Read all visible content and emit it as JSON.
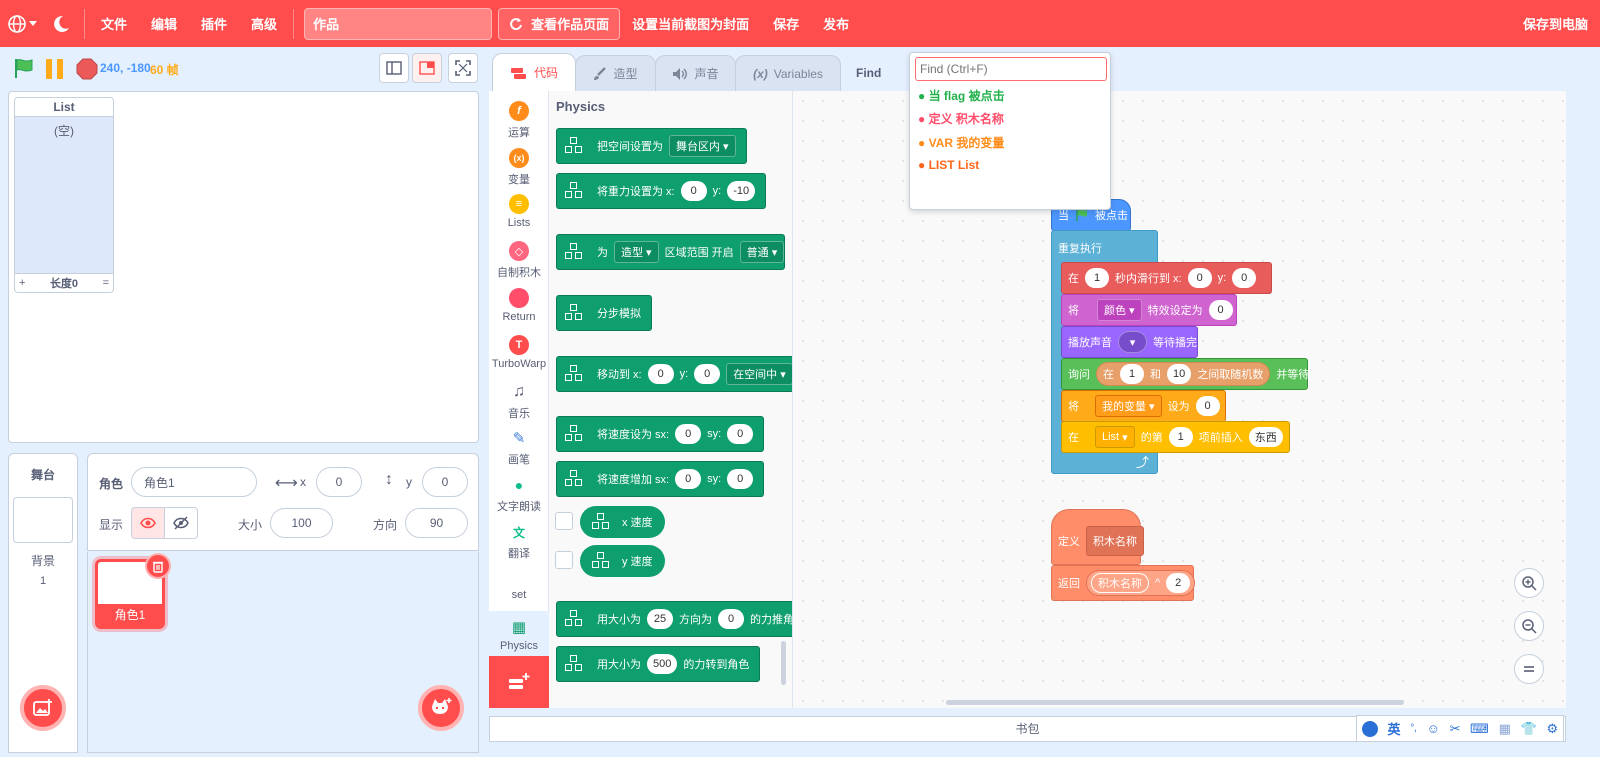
{
  "menubar": {
    "items": [
      "文件",
      "编辑",
      "插件",
      "高级"
    ],
    "project_title": "作品",
    "see_project": "查看作品页面",
    "set_cover": "设置当前截图为封面",
    "save": "保存",
    "publish": "发布",
    "save_local": "保存到电脑"
  },
  "stage_header": {
    "coords": "240, -180",
    "fps": "60 帧"
  },
  "list_monitor": {
    "title": "List",
    "empty": "(空)",
    "add": "+",
    "length": "长度0",
    "resize": "="
  },
  "stage_panel": {
    "label": "舞台",
    "backdrop_label": "背景",
    "backdrop_count": "1"
  },
  "sprite_info": {
    "sprite_label": "角色",
    "sprite_name": "角色1",
    "x_label": "x",
    "x_value": "0",
    "y_label": "y",
    "y_value": "0",
    "show_label": "显示",
    "size_label": "大小",
    "size_value": "100",
    "direction_label": "方向",
    "direction_value": "90"
  },
  "sprite_list": {
    "sprites": [
      {
        "name": "角色1"
      }
    ]
  },
  "tabs": {
    "code": "代码",
    "costumes": "造型",
    "sounds": "声音",
    "variables": "Variables",
    "find": "Find"
  },
  "categories": [
    {
      "label": "运算",
      "color": "#ff8c1a",
      "glyph": "f"
    },
    {
      "label": "变量",
      "color": "#ff8c1a",
      "glyph": "x"
    },
    {
      "label": "Lists",
      "color": "#ffbf00",
      "glyph": "≡"
    },
    {
      "label": "自制积木",
      "color": "#ff6680",
      "glyph": "◇"
    },
    {
      "label": "Return",
      "color": "#ff4d6a",
      "glyph": ""
    },
    {
      "label": "TurboWarp",
      "color": "#ff4c4c",
      "glyph": "T"
    },
    {
      "label": "音乐",
      "color": "#575e75",
      "glyph": "♫"
    },
    {
      "label": "画笔",
      "color": "#3f7ee0",
      "glyph": "✎"
    },
    {
      "label": "文字朗读",
      "color": "#0fbd8c",
      "glyph": "●"
    },
    {
      "label": "翻译",
      "color": "#0fbd8c",
      "glyph": "文"
    },
    {
      "label": "set",
      "color": "#e5f0ff",
      "glyph": ""
    },
    {
      "label": "Physics",
      "color": "#0f9e6e",
      "glyph": "▦"
    }
  ],
  "flyout": {
    "title": "Physics",
    "blocks": {
      "b1_text": "把空间设置为",
      "b1_dd": "舞台区内",
      "b2_text": "将重力设置为 x:",
      "b2_x": "0",
      "b2_y_label": "y:",
      "b2_y": "-10",
      "b3_text": "为",
      "b3_dd": "造型",
      "b3_text2": "区域范围 开启",
      "b3_dd2": "普通",
      "b4_text": "分步模拟",
      "b5_text": "移动到 x:",
      "b5_x": "0",
      "b5_y_label": "y:",
      "b5_y": "0",
      "b5_dd": "在空间中",
      "b6_text": "将速度设为 sx:",
      "b6_sx": "0",
      "b6_sy_label": "sy:",
      "b6_sy": "0",
      "b7_text": "将速度增加 sx:",
      "b7_sx": "0",
      "b7_sy_label": "sy:",
      "b7_sy": "0",
      "r1_text": "x 速度",
      "r2_text": "y 速度",
      "b8_text": "用大小为",
      "b8_size": "25",
      "b8_text2": "方向为",
      "b8_dir": "0",
      "b8_text3": "的力推角",
      "b9_text": "用大小为",
      "b9_size": "500",
      "b9_text2": "的力转到角色"
    }
  },
  "find_popup": {
    "placeholder": "Find (Ctrl+F)",
    "results": [
      {
        "text": "● 当 flag 被点击",
        "color": "#22b14c"
      },
      {
        "text": "● 定义 积木名称",
        "color": "#ff4d6a"
      },
      {
        "text": "● VAR 我的变量",
        "color": "#ff8c1a"
      },
      {
        "text": "● LIST List",
        "color": "#ff661a"
      }
    ]
  },
  "script": {
    "hat_when": "当",
    "hat_clicked": "被点击",
    "forever": "重复执行",
    "glide_in": "在",
    "glide_secs": "1",
    "glide_text": "秒内滑行到 x:",
    "glide_x": "0",
    "glide_y_label": "y:",
    "glide_y": "0",
    "effect_set": "将",
    "effect_dd": "颜色",
    "effect_text": "特效设定为",
    "effect_val": "0",
    "sound_text": "播放声音",
    "sound_text2": "等待播完",
    "ask_text": "询问",
    "ask_in": "在",
    "ask_from": "1",
    "ask_and": "和",
    "ask_to": "10",
    "ask_random": "之间取随机数",
    "ask_wait": "并等待",
    "var_set": "将",
    "var_dd": "我的变量",
    "var_text": "设为",
    "var_val": "0",
    "list_in": "在",
    "list_dd": "List",
    "list_text": "的第",
    "list_idx": "1",
    "list_text2": "项前插入",
    "list_item": "东西",
    "define_text": "定义",
    "define_name": "积木名称",
    "return_text": "返回",
    "return_name": "积木名称",
    "return_op": "^",
    "return_val": "2"
  },
  "backpack": {
    "label": "书包"
  },
  "ime_bar": {
    "lang": "英",
    "punct": "°,"
  }
}
